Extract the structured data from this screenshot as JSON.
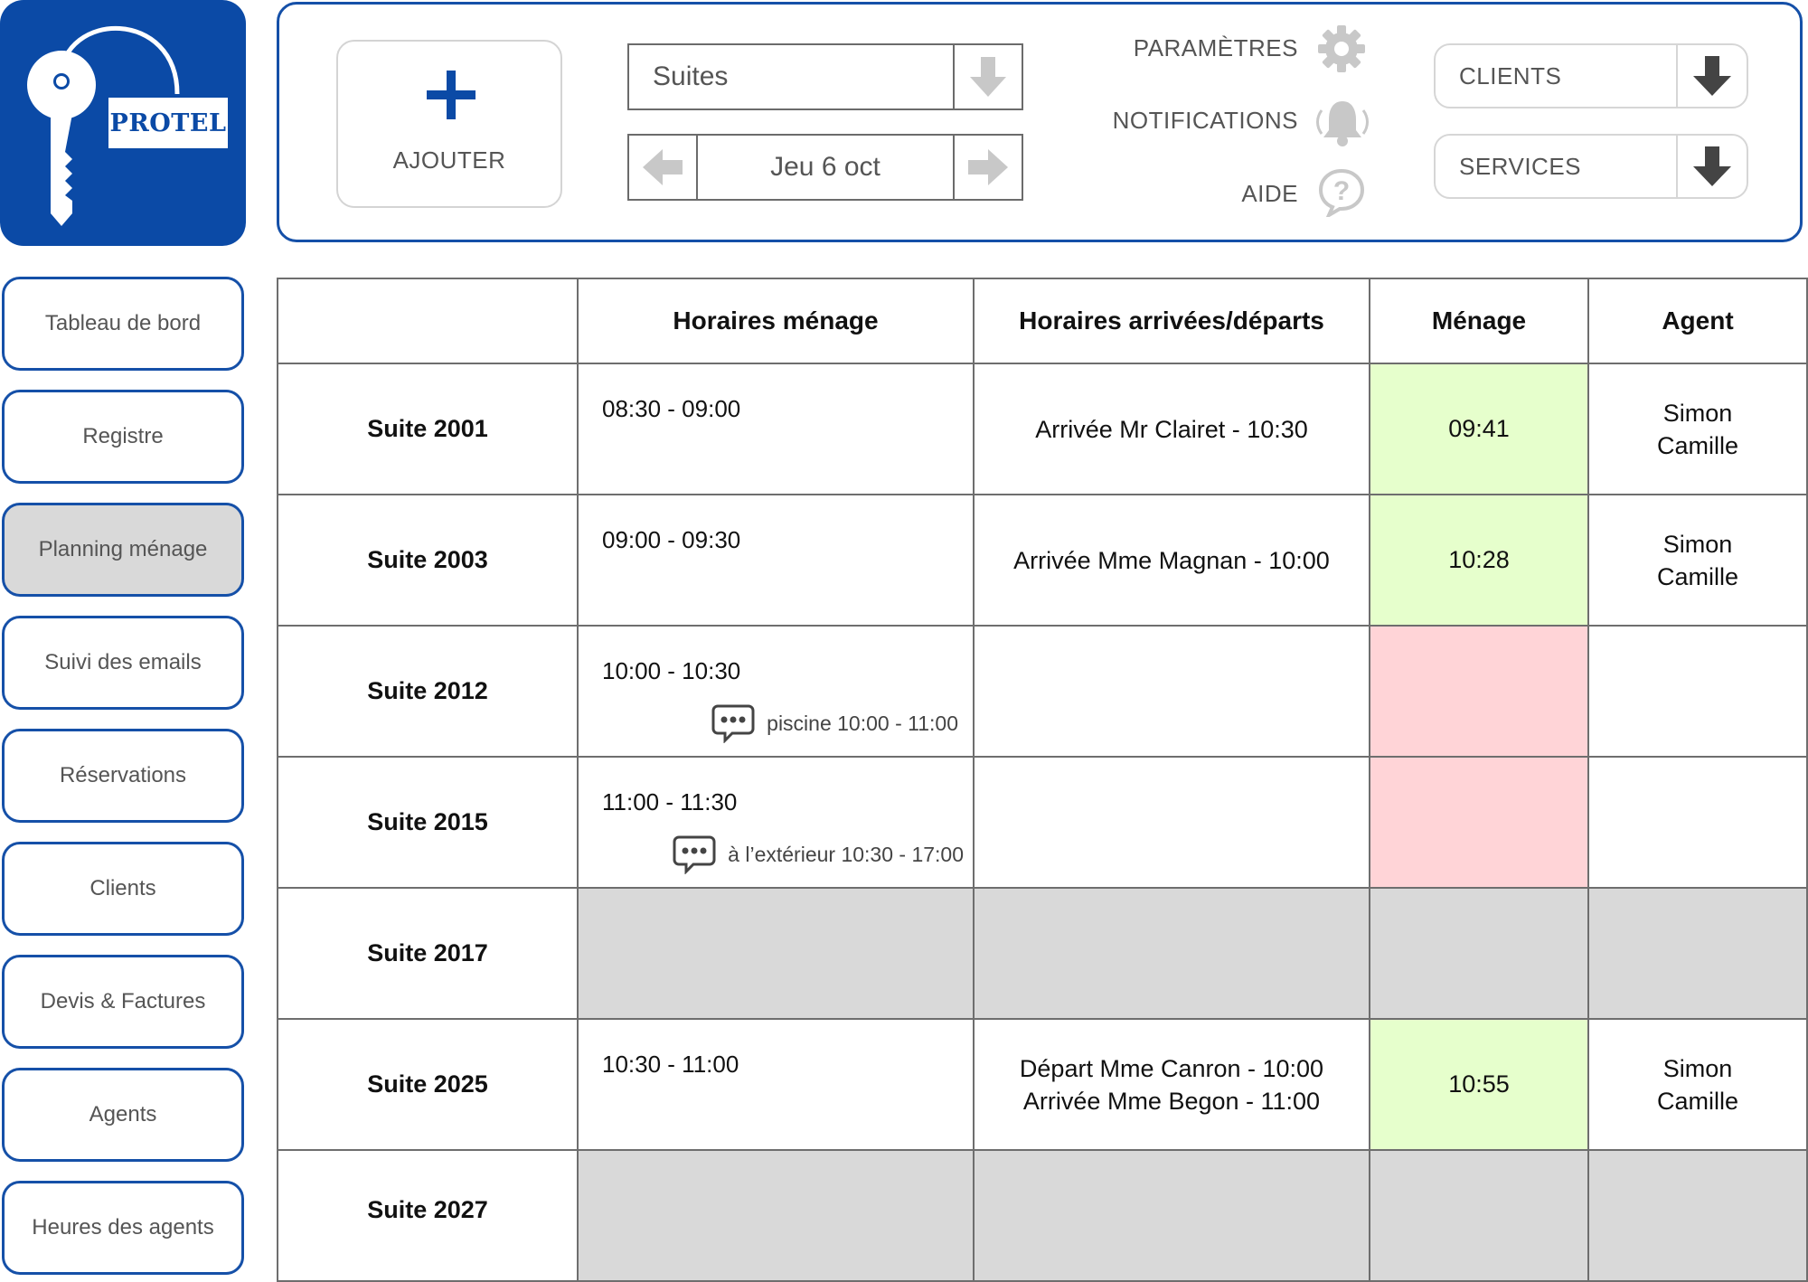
{
  "app": {
    "logo_text": "PROTEL",
    "brand_color": "#0b4aa6"
  },
  "toolbar": {
    "add_label": "AJOUTER",
    "suite_select_value": "Suites",
    "date_value": "Jeu 6 oct",
    "settings_label": "PARAMÈTRES",
    "notifications_label": "NOTIFICATIONS",
    "help_label": "AIDE",
    "clients_dropdown": "CLIENTS",
    "services_dropdown": "SERVICES",
    "icons": [
      "plus-icon",
      "arrow-down-icon",
      "arrow-left-icon",
      "arrow-right-icon",
      "gear-icon",
      "bell-icon",
      "help-icon"
    ]
  },
  "sidebar": {
    "items": [
      {
        "label": "Tableau de bord"
      },
      {
        "label": "Registre"
      },
      {
        "label": "Planning ménage",
        "active": true
      },
      {
        "label": "Suivi des emails"
      },
      {
        "label": "Réservations"
      },
      {
        "label": "Clients"
      },
      {
        "label": "Devis & Factures"
      },
      {
        "label": "Agents"
      },
      {
        "label": "Heures des agents"
      }
    ]
  },
  "table": {
    "headers": [
      "",
      "Horaires ménage",
      "Horaires arrivées/départs",
      "Ménage",
      "Agent"
    ],
    "status_colors": {
      "done": "#e6ffcc",
      "pending": "#ffd4d7",
      "unused": "#d9d9d9"
    },
    "rows": [
      {
        "suite": "Suite 2001",
        "cleaning": "08:30 - 09:00",
        "note": "",
        "arrivals": [
          "Arrivée Mr Clairet - 10:30"
        ],
        "menage": "09:41",
        "status": "done",
        "agent": [
          "Simon",
          "Camille"
        ]
      },
      {
        "suite": "Suite 2003",
        "cleaning": "09:00 - 09:30",
        "note": "",
        "arrivals": [
          "Arrivée Mme Magnan - 10:00"
        ],
        "menage": "10:28",
        "status": "done",
        "agent": [
          "Simon",
          "Camille"
        ]
      },
      {
        "suite": "Suite 2012",
        "cleaning": "10:00 - 10:30",
        "note": "piscine 10:00 - 11:00",
        "arrivals": [],
        "menage": "",
        "status": "pending",
        "agent": []
      },
      {
        "suite": "Suite 2015",
        "cleaning": "11:00 - 11:30",
        "note": "à l’extérieur 10:30 - 17:00",
        "arrivals": [],
        "menage": "",
        "status": "pending",
        "agent": []
      },
      {
        "suite": "Suite 2017",
        "cleaning": "",
        "note": "",
        "arrivals": [],
        "menage": "",
        "status": "unused",
        "agent": []
      },
      {
        "suite": "Suite 2025",
        "cleaning": "10:30 - 11:00",
        "note": "",
        "arrivals": [
          "Départ Mme Canron - 10:00",
          "Arrivée Mme Begon - 11:00"
        ],
        "menage": "10:55",
        "status": "done",
        "agent": [
          "Simon",
          "Camille"
        ]
      },
      {
        "suite": "Suite 2027",
        "cleaning": "",
        "note": "",
        "arrivals": [],
        "menage": "",
        "status": "unused",
        "agent": []
      }
    ]
  }
}
